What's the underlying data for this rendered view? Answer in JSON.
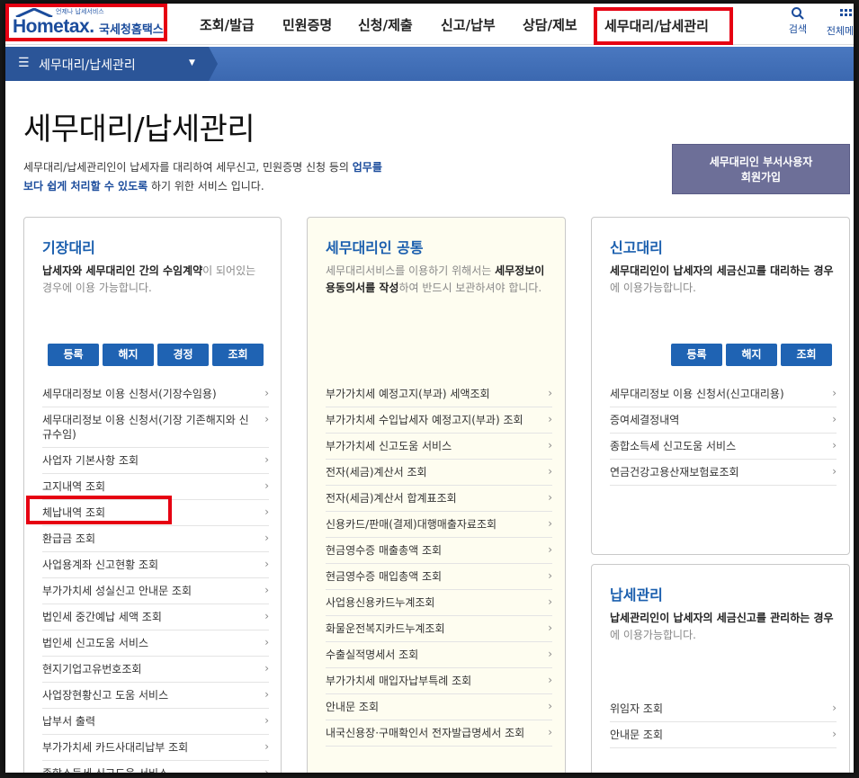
{
  "header": {
    "logo_small": "언제나 납세서비스",
    "logo_en": "Hometax.",
    "logo_kr": "국세청홈택스",
    "nav": [
      "조회/발급",
      "민원증명",
      "신청/제출",
      "신고/납부",
      "상담/제보",
      "세무대리/납세관리"
    ],
    "search_label": "검색",
    "all_label": "전체메"
  },
  "subnav": {
    "label": "세무대리/납세관리"
  },
  "page": {
    "title": "세무대리/납세관리",
    "desc_1": "세무대리/납세관리인이 납세자를 대리하여 세무신고, 민원증명 신청 등의 ",
    "desc_hl_1": "업무를",
    "desc_hl_2": "보다 쉽게 처리할 수 있도록",
    "desc_2": " 하기 위한 서비스 입니다.",
    "join_line1": "세무대리인 부서사용자",
    "join_line2": "회원가입"
  },
  "cards": {
    "bookkeeping": {
      "title": "기장대리",
      "desc_bold": "납세자와 세무대리인 간의 수임계약",
      "desc_rest": "이 되어있는 경우에 이용 가능합니다.",
      "buttons": [
        "등록",
        "해지",
        "경정",
        "조회"
      ],
      "items": [
        "세무대리정보 이용 신청서(기장수임용)",
        "세무대리정보 이용 신청서(기장 기존해지와 신규수임)",
        "사업자 기본사항 조회",
        "고지내역 조회",
        "체납내역 조회",
        "환급금 조회",
        "사업용계좌 신고현황 조회",
        "부가가치세 성실신고 안내문 조회",
        "법인세 중간예납 세액 조회",
        "법인세 신고도움 서비스",
        "현지기업고유번호조회",
        "사업장현황신고 도움 서비스",
        "납부서 출력",
        "부가가치세 카드사대리납부 조회",
        "종합소득세 신고도움 서비스"
      ]
    },
    "common": {
      "title": "세무대리인 공통",
      "desc_pre": "세무대리서비스를 이용하기 위해서는 ",
      "desc_bold": "세무정보이용동의서를 작성",
      "desc_rest": "하여 반드시 보관하셔야 합니다.",
      "items": [
        "부가가치세 예정고지(부과) 세액조회",
        "부가가치세 수입납세자 예정고지(부과) 조회",
        "부가가치세 신고도움 서비스",
        "전자(세금)계산서 조회",
        "전자(세금)계산서 합계표조회",
        "신용카드/판매(결제)대행매출자료조회",
        "현금영수증 매출총액 조회",
        "현금영수증 매입총액 조회",
        "사업용신용카드누계조회",
        "화물운전복지카드누계조회",
        "수출실적명세서 조회",
        "부가가치세 매입자납부특례 조회",
        "안내문 조회",
        "내국신용장·구매확인서 전자발급명세서 조회"
      ]
    },
    "filing": {
      "title": "신고대리",
      "desc_bold": "세무대리인이 납세자의 세금신고를 대리하는 경우",
      "desc_rest": "에 이용가능합니다.",
      "buttons": [
        "등록",
        "해지",
        "조회"
      ],
      "items": [
        "세무대리정보 이용 신청서(신고대리용)",
        "증여세결정내역",
        "종합소득세 신고도움 서비스",
        "연금건강고용산재보험료조회"
      ]
    },
    "tax_admin": {
      "title": "납세관리",
      "desc_bold": "납세관리인이 납세자의 세금신고를 관리하는 경우",
      "desc_rest": "에 이용가능합니다.",
      "items": [
        "위임자 조회",
        "안내문 조회"
      ]
    }
  },
  "colors": {
    "accent": "#1f63b3",
    "highlight_box": "#e60012",
    "join_button": "#6d6f98"
  },
  "icons": {
    "chevron": "chevron-right-icon",
    "search": "search-icon",
    "menu": "hamburger-icon"
  }
}
